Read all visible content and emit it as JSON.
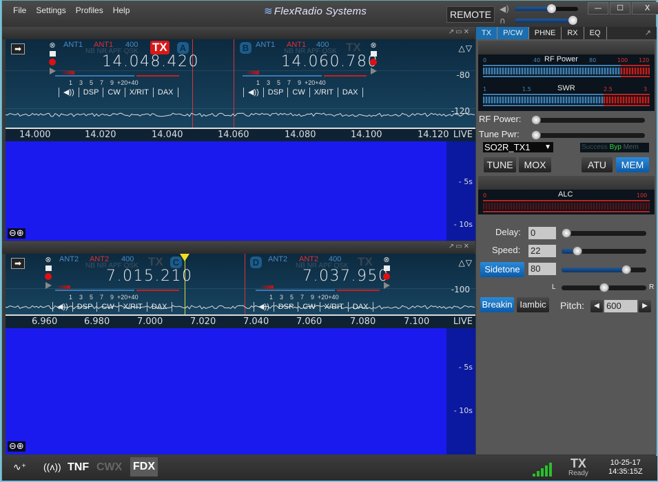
{
  "menu": {
    "file": "File",
    "settings": "Settings",
    "profiles": "Profiles",
    "help": "Help"
  },
  "brand": {
    "logo": "≋",
    "name": "FlexRadio Systems"
  },
  "titlebar": {
    "remote_label": "REMOTE",
    "speaker_volume_pct": 60,
    "headphone_volume_pct": 100,
    "minimize": "—",
    "maximize": "☐",
    "close": "X"
  },
  "panel_controls": "↗▭✕",
  "panadapter1": {
    "db_labels": [
      "-80",
      "-120"
    ],
    "freq_ticks": [
      "14.000",
      "14.020",
      "14.040",
      "14.060",
      "14.080",
      "14.100",
      "14.120"
    ],
    "live_label": "LIVE",
    "wf_time_labels": [
      "- 5s",
      "- 10s"
    ],
    "zoom_out": "⊖",
    "zoom_in": "⊕",
    "slices": [
      {
        "letter": "A",
        "rx_ant": "ANT1",
        "tx_ant": "ANT1",
        "filter": "400",
        "flags": "NB NR APF QSK",
        "tx": "TX",
        "tx_active": true,
        "freq": "14.048.420"
      },
      {
        "letter": "B",
        "rx_ant": "ANT1",
        "tx_ant": "ANT1",
        "filter": "400",
        "flags": "NB NR APF QSK",
        "tx": "TX",
        "tx_active": false,
        "freq": "14.060.780"
      }
    ]
  },
  "panadapter2": {
    "db_labels": [
      "-100"
    ],
    "freq_ticks": [
      "6.960",
      "6.980",
      "7.000",
      "7.020",
      "7.040",
      "7.060",
      "7.080",
      "7.100"
    ],
    "live_label": "LIVE",
    "wf_time_labels": [
      "- 5s",
      "- 10s"
    ],
    "zoom_out": "⊖",
    "zoom_in": "⊕",
    "slices": [
      {
        "letter": "C",
        "rx_ant": "ANT2",
        "tx_ant": "ANT2",
        "filter": "400",
        "flags": "NB NR APF QSK",
        "tx": "TX",
        "tx_active": false,
        "freq": "7.015.210"
      },
      {
        "letter": "D",
        "rx_ant": "ANT2",
        "tx_ant": "ANT2",
        "filter": "400",
        "flags": "NB NR APF QSK",
        "tx": "TX",
        "tx_active": false,
        "freq": "7.037.950"
      }
    ]
  },
  "slice_common": {
    "s_ticks": "1    3    5    7    9  +20+40",
    "buttons": {
      "audio": "◀))",
      "dsp": "DSP",
      "cw": "CW",
      "xrit": "X/RIT",
      "dax": "DAX"
    }
  },
  "right_panel": {
    "tabs": [
      "TX",
      "P/CW",
      "PHNE",
      "RX",
      "EQ"
    ],
    "active_tabs": [
      "TX",
      "P/CW"
    ],
    "rf_meter": {
      "title": "RF Power",
      "ticks": [
        "0",
        "40",
        "80",
        "100",
        "120"
      ]
    },
    "swr_meter": {
      "title": "SWR",
      "ticks": [
        "1",
        "1.5",
        "2.5",
        "3"
      ]
    },
    "rf_power_label": "RF Power:",
    "rf_power_pct": 0,
    "tune_pwr_label": "Tune Pwr:",
    "tune_pwr_pct": 0,
    "tx_profile": "SO2R_TX1",
    "atu_status": {
      "success": "Success",
      "byp": "Byp",
      "mem": "Mem"
    },
    "tune": "TUNE",
    "mox": "MOX",
    "atu": "ATU",
    "mem": "MEM",
    "alc_meter": {
      "title": "ALC",
      "ticks": [
        "0",
        "100"
      ]
    },
    "delay_label": "Delay:",
    "delay_value": "0",
    "delay_pct": 0,
    "speed_label": "Speed:",
    "speed_value": "22",
    "speed_pct": 15,
    "sidetone_label": "Sidetone",
    "sidetone_value": "80",
    "sidetone_pct": 80,
    "pan_left": "L",
    "pan_right": "R",
    "pan_pct": 50,
    "breakin": "Breakin",
    "iambic": "Iambic",
    "pitch_label": "Pitch:",
    "pitch_value": "600"
  },
  "statusbar": {
    "tnf": "TNF",
    "cwx": "CWX",
    "fdx": "FDX",
    "tx": "TX",
    "ready": "Ready",
    "date": "10-25-17",
    "time": "14:35:15Z",
    "signal_bars": 5
  }
}
